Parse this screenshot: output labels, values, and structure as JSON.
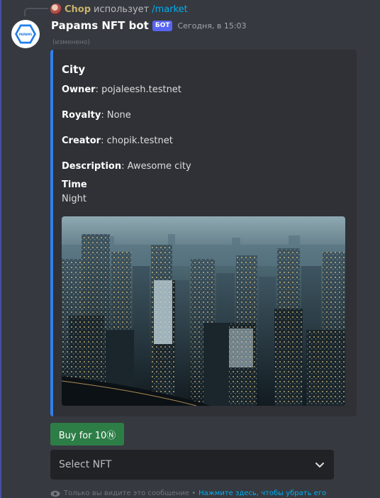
{
  "reply": {
    "username": "Chop",
    "action": "использует",
    "command": "/market"
  },
  "message": {
    "author": "Papams NFT bot",
    "tag": "БОТ",
    "timestamp": "Сегодня, в 15:03",
    "edited": "(изменено)",
    "avatar_text": "PAPAMS"
  },
  "embed": {
    "accent_color": "#2f80ed",
    "title": "City",
    "fields": [
      {
        "name": "Owner",
        "value": "pojaleesh.testnet"
      },
      {
        "name": "Royalty",
        "value": "None"
      },
      {
        "name": "Creator",
        "value": "chopik.testnet"
      },
      {
        "name": "Description",
        "value": "Awesome city"
      }
    ],
    "time_field": {
      "name": "Time",
      "value": "Night"
    }
  },
  "components": {
    "buy_button": "Buy for 10Ⓝ",
    "buy_button_color": "#2d7d46",
    "select_placeholder": "Select NFT"
  },
  "footer": {
    "text": "Только вы видите это сообщение •",
    "link": "Нажмите здесь, чтобы убрать его"
  }
}
